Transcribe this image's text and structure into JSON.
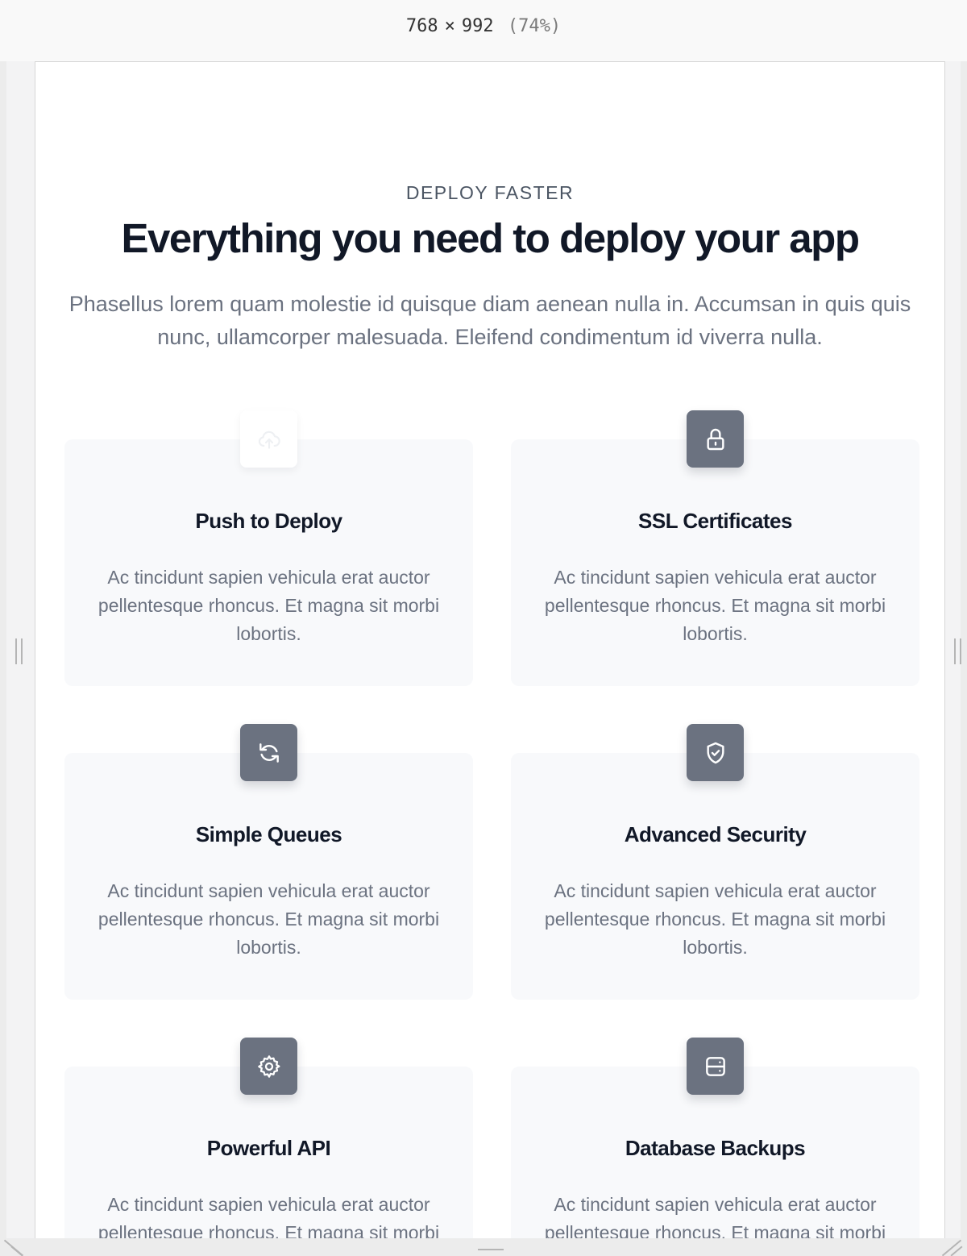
{
  "responsive_bar": {
    "width": "768",
    "times": "×",
    "height": "992",
    "zoom": "(74%)"
  },
  "section": {
    "eyebrow": "DEPLOY FASTER",
    "headline": "Everything you need to deploy your app",
    "lead": "Phasellus lorem quam molestie id quisque diam aenean nulla in. Accumsan in quis quis nunc, ullamcorper malesuada. Eleifend condimentum id viverra nulla."
  },
  "features": [
    {
      "title": "Push to Deploy",
      "icon": "cloud-upload-icon",
      "body": "Ac tincidunt sapien vehicula erat auctor pellentesque rhoncus. Et magna sit morbi lobortis."
    },
    {
      "title": "SSL Certificates",
      "icon": "lock-icon",
      "body": "Ac tincidunt sapien vehicula erat auctor pellentesque rhoncus. Et magna sit morbi lobortis."
    },
    {
      "title": "Simple Queues",
      "icon": "refresh-icon",
      "body": "Ac tincidunt sapien vehicula erat auctor pellentesque rhoncus. Et magna sit morbi lobortis."
    },
    {
      "title": "Advanced Security",
      "icon": "shield-check-icon",
      "body": "Ac tincidunt sapien vehicula erat auctor pellentesque rhoncus. Et magna sit morbi lobortis."
    },
    {
      "title": "Powerful API",
      "icon": "cog-icon",
      "body": "Ac tincidunt sapien vehicula erat auctor pellentesque rhoncus. Et magna sit morbi lobortis."
    },
    {
      "title": "Database Backups",
      "icon": "server-icon",
      "body": "Ac tincidunt sapien vehicula erat auctor pellentesque rhoncus. Et magna sit morbi lobortis."
    }
  ],
  "colors": {
    "icon_background": "#6b7280",
    "card_background": "#f8f9fb",
    "heading": "#111827",
    "body_text": "#6b7280"
  }
}
